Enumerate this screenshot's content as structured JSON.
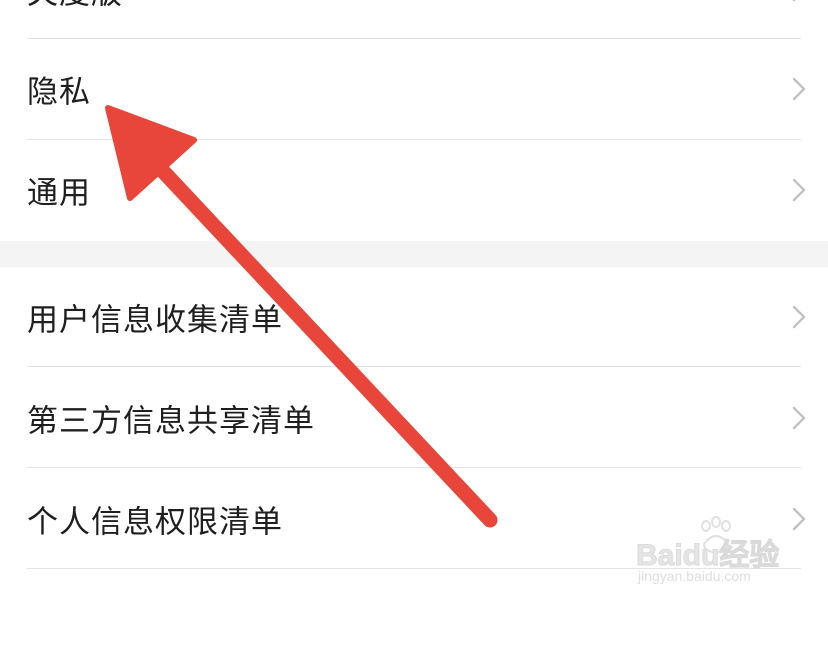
{
  "settings": {
    "items": [
      {
        "label": "夫度版"
      },
      {
        "label": "隐私"
      },
      {
        "label": "通用"
      },
      {
        "label": "用户信息收集清单"
      },
      {
        "label": "第三方信息共享清单"
      },
      {
        "label": "个人信息权限清单"
      },
      {
        "label": ""
      }
    ]
  },
  "watermark": {
    "brand": "Baidu经验",
    "url": "jingyan.baidu.com"
  },
  "annotation": {
    "arrow_color": "#e8463a",
    "target": "隐私"
  },
  "colors": {
    "divider": "#e3e3e3",
    "section_gap": "#f4f4f4",
    "chevron": "#c2c2c2"
  }
}
